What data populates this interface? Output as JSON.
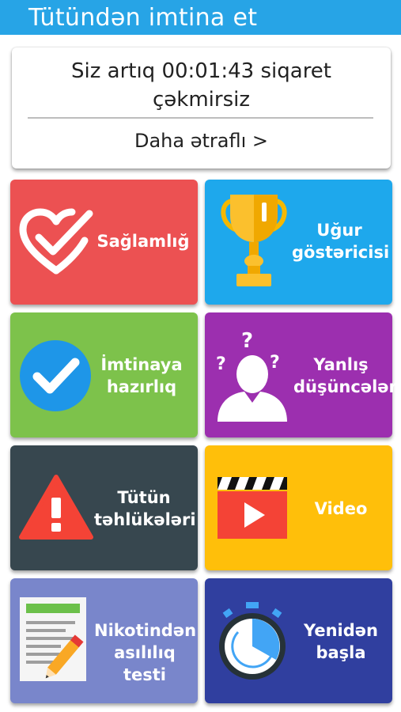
{
  "header": {
    "title": "Tütündən imtina et"
  },
  "status_card": {
    "message": "Siz artıq 00:01:43 siqaret çəkmirsiz",
    "more_label": "Daha ətraflı  >"
  },
  "tiles": [
    {
      "label": "Sağlamlığ",
      "icon": "heart-check-icon",
      "color": "#ec5152"
    },
    {
      "label": "Uğur\ngöstəricisi",
      "icon": "trophy-icon",
      "color": "#1ea8ec"
    },
    {
      "label": "İmtinaya\nhazırlıq",
      "icon": "check-circle-icon",
      "color": "#7dc24b"
    },
    {
      "label": "Yanlış\ndüşüncələr",
      "icon": "confused-person-icon",
      "color": "#9c2faf"
    },
    {
      "label": "Tütün\ntəhlükələri",
      "icon": "warning-icon",
      "color": "#37474f"
    },
    {
      "label": "Video",
      "icon": "video-clapper-icon",
      "color": "#ffbf0a"
    },
    {
      "label": "Nikotindən\nasılılıq testi",
      "icon": "test-document-icon",
      "color": "#7986cb"
    },
    {
      "label": "Yenidən\nbaşla",
      "icon": "stopwatch-icon",
      "color": "#303f9f"
    }
  ]
}
